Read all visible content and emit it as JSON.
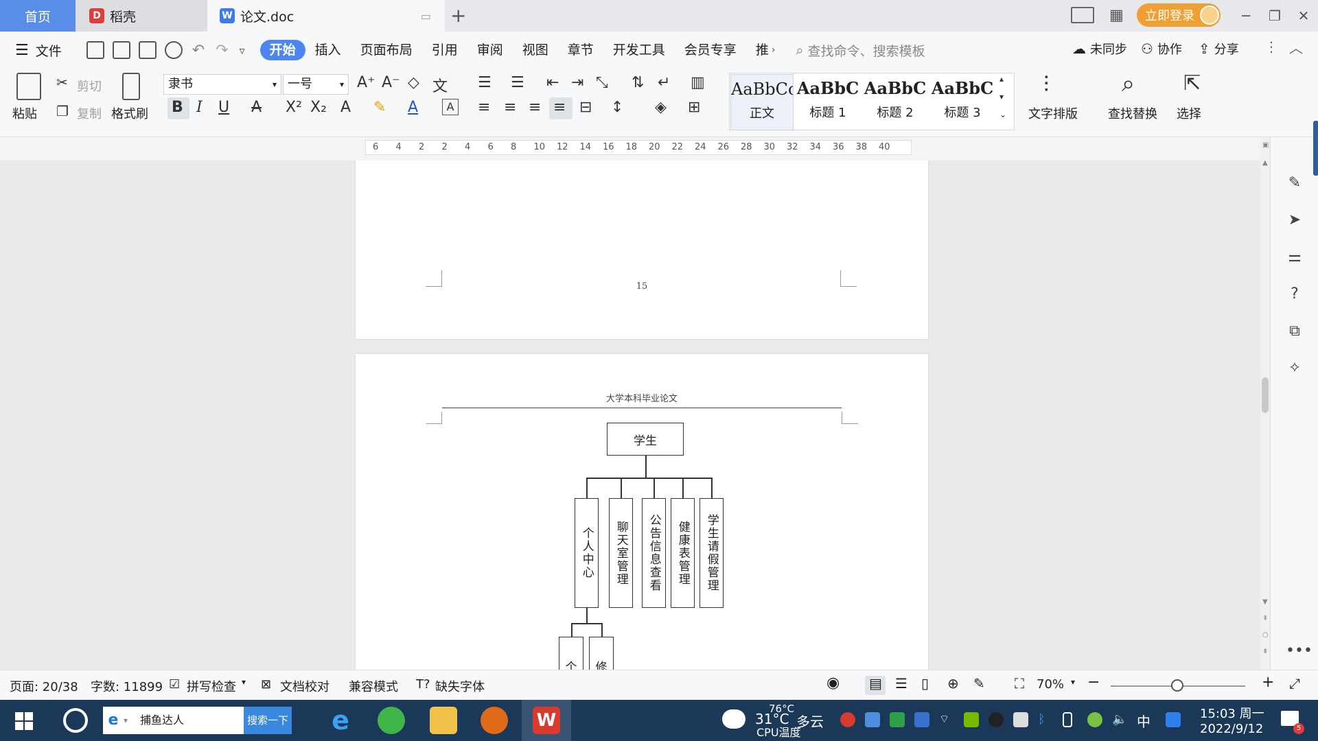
{
  "tabs": {
    "home": "首页",
    "daoke": "稻壳",
    "doc": "论文.doc"
  },
  "titlebar": {
    "login": "立即登录"
  },
  "menu": {
    "file": "文件",
    "items": [
      "开始",
      "插入",
      "页面布局",
      "引用",
      "审阅",
      "视图",
      "章节",
      "开发工具",
      "会员专享",
      "推"
    ],
    "search_placeholder": "查找命令、搜索模板",
    "sync": "未同步",
    "collab": "协作",
    "share": "分享"
  },
  "ribbon": {
    "paste": "粘贴",
    "cut": "剪切",
    "copy": "复制",
    "format_painter": "格式刷",
    "font_name": "隶书",
    "font_size": "一号",
    "styles": [
      {
        "sample": "AaBbCcI",
        "name": "正文"
      },
      {
        "sample": "AaBbC",
        "name": "标题 1"
      },
      {
        "sample": "AaBbC",
        "name": "标题 2"
      },
      {
        "sample": "AaBbC",
        "name": "标题 3"
      }
    ],
    "text_layout": "文字排版",
    "find_replace": "查找替换",
    "select": "选择"
  },
  "ruler": {
    "ticks": [
      "6",
      "4",
      "2",
      "2",
      "4",
      "6",
      "8",
      "10",
      "12",
      "14",
      "16",
      "18",
      "20",
      "22",
      "24",
      "26",
      "28",
      "30",
      "32",
      "34",
      "36",
      "38",
      "40"
    ]
  },
  "document": {
    "page_number": "15",
    "header_text": "大学本科毕业论文",
    "diagram": {
      "root": "学生",
      "children": [
        "个人中心",
        "聊天室管理",
        "公告信息查看",
        "健康表管理",
        "学生请假管理"
      ],
      "grandchildren": [
        "个",
        "修"
      ]
    }
  },
  "statusbar": {
    "page": "页面: 20/38",
    "words": "字数: 11899",
    "spellcheck": "拼写检查",
    "proofread": "文档校对",
    "compat": "兼容模式",
    "missing_font": "缺失字体",
    "zoom": "70%"
  },
  "taskbar": {
    "search_text": "捕鱼达人",
    "search_button": "搜索一下",
    "weather_temp": "31°C",
    "weather_desc": "多云",
    "cpu_temp": "76°C",
    "cpu_label": "CPU温度",
    "ime": "中",
    "time": "15:03 周一",
    "date": "2022/9/12"
  },
  "colors": {
    "accent": "#4d86ee",
    "login": "#f0a032",
    "taskbar": "#1c3859"
  }
}
